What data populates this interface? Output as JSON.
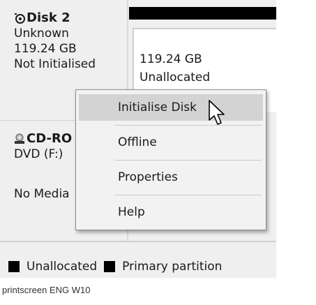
{
  "disk2": {
    "title": "Disk 2",
    "type": "Unknown",
    "size": "119.24 GB",
    "status": "Not Initialised"
  },
  "volume": {
    "size": "119.24 GB",
    "status": "Unallocated"
  },
  "cdrom": {
    "title": "CD-RO",
    "drive": "DVD (F:)",
    "media": "No Media"
  },
  "context_menu": {
    "items": [
      {
        "label": "Initialise Disk",
        "highlighted": true
      },
      {
        "label": "Offline"
      },
      {
        "label": "Properties"
      },
      {
        "label": "Help"
      }
    ]
  },
  "legend": {
    "unallocated": "Unallocated",
    "primary": "Primary partition",
    "swatch_color": "#000000"
  },
  "caption": "printscreen ENG W10"
}
